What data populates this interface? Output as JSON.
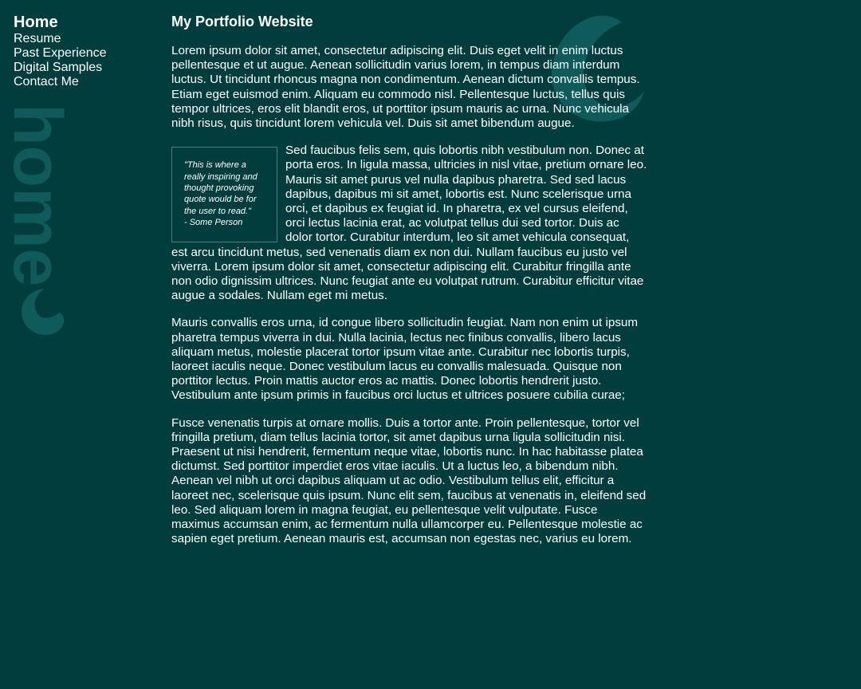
{
  "nav": {
    "items": [
      {
        "label": "Home",
        "active": true
      },
      {
        "label": "Resume",
        "active": false
      },
      {
        "label": "Past Experience",
        "active": false
      },
      {
        "label": "Digital Samples",
        "active": false
      },
      {
        "label": "Contact Me",
        "active": false
      }
    ],
    "decorative_word": "home"
  },
  "colors": {
    "background": "#023d3e",
    "text": "#ffffff",
    "decoration": "#0f5b5c",
    "quote_border": "#4e7b7b"
  },
  "main": {
    "title": "My Portfolio Website",
    "paragraphs": [
      "Lorem ipsum dolor sit amet, consectetur adipiscing elit. Duis eget velit in enim luctus pellentesque et ut augue. Aenean sollicitudin varius lorem, in tempus diam interdum luctus. Ut tincidunt rhoncus magna non condimentum. Aenean dictum convallis tempus. Etiam eget euismod enim. Aliquam eu commodo nisl. Pellentesque luctus, tellus quis tempor ultrices, eros elit blandit eros, ut porttitor ipsum mauris ac urna. Nunc vehicula nibh risus, quis tincidunt lorem vehicula vel. Duis sit amet bibendum augue.",
      "Sed faucibus felis sem, quis lobortis nibh vestibulum non. Donec at porta eros. In ligula massa, ultricies in nisl vitae, pretium ornare leo. Mauris sit amet purus vel nulla dapibus pharetra. Sed sed lacus dapibus, dapibus mi sit amet, lobortis est. Nunc scelerisque urna orci, et dapibus ex feugiat id. In pharetra, ex vel cursus eleifend, orci lectus lacinia erat, ac volutpat tellus dui sed tortor. Duis ac dolor tortor. Curabitur interdum, leo sit amet vehicula consequat, est arcu tincidunt metus, sed venenatis diam ex non dui. Nullam faucibus eu justo vel viverra. Lorem ipsum dolor sit amet, consectetur adipiscing elit. Curabitur fringilla ante non odio dignissim ultrices. Nunc feugiat ante eu volutpat rutrum. Curabitur efficitur vitae augue a sodales. Nullam eget mi metus.",
      "Mauris convallis eros urna, id congue libero sollicitudin feugiat. Nam non enim ut ipsum pharetra tempus viverra in dui. Nulla lacinia, lectus nec finibus convallis, libero lacus aliquam metus, molestie placerat tortor ipsum vitae ante. Curabitur nec lobortis turpis, laoreet iaculis neque. Donec vestibulum lacus eu convallis malesuada. Quisque non porttitor lectus. Proin mattis auctor eros ac mattis. Donec lobortis hendrerit justo. Vestibulum ante ipsum primis in faucibus orci luctus et ultrices posuere cubilia curae;",
      "Fusce venenatis turpis at ornare mollis. Duis a tortor ante. Proin pellentesque, tortor vel fringilla pretium, diam tellus lacinia tortor, sit amet dapibus urna ligula sollicitudin nisi. Praesent ut nisi hendrerit, fermentum neque vitae, lobortis nunc. In hac habitasse platea dictumst. Sed porttitor imperdiet eros vitae iaculis. Ut a luctus leo, a bibendum nibh. Aenean vel nibh ut orci dapibus aliquam ut ac odio. Vestibulum tellus elit, efficitur a laoreet nec, scelerisque quis ipsum. Nunc elit sem, faucibus at venenatis in, eleifend sed leo. Sed aliquam lorem in magna feugiat, eu pellentesque velit vulputate. Fusce maximus accumsan enim, ac fermentum nulla ullamcorper eu. Pellentesque molestie ac sapien eget pretium. Aenean mauris est, accumsan non egestas nec, varius eu lorem."
    ],
    "quote": {
      "text": "\"This is where a really inspiring and thought provoking quote would be for the user to read.\"",
      "attribution": "- Some Person"
    }
  }
}
